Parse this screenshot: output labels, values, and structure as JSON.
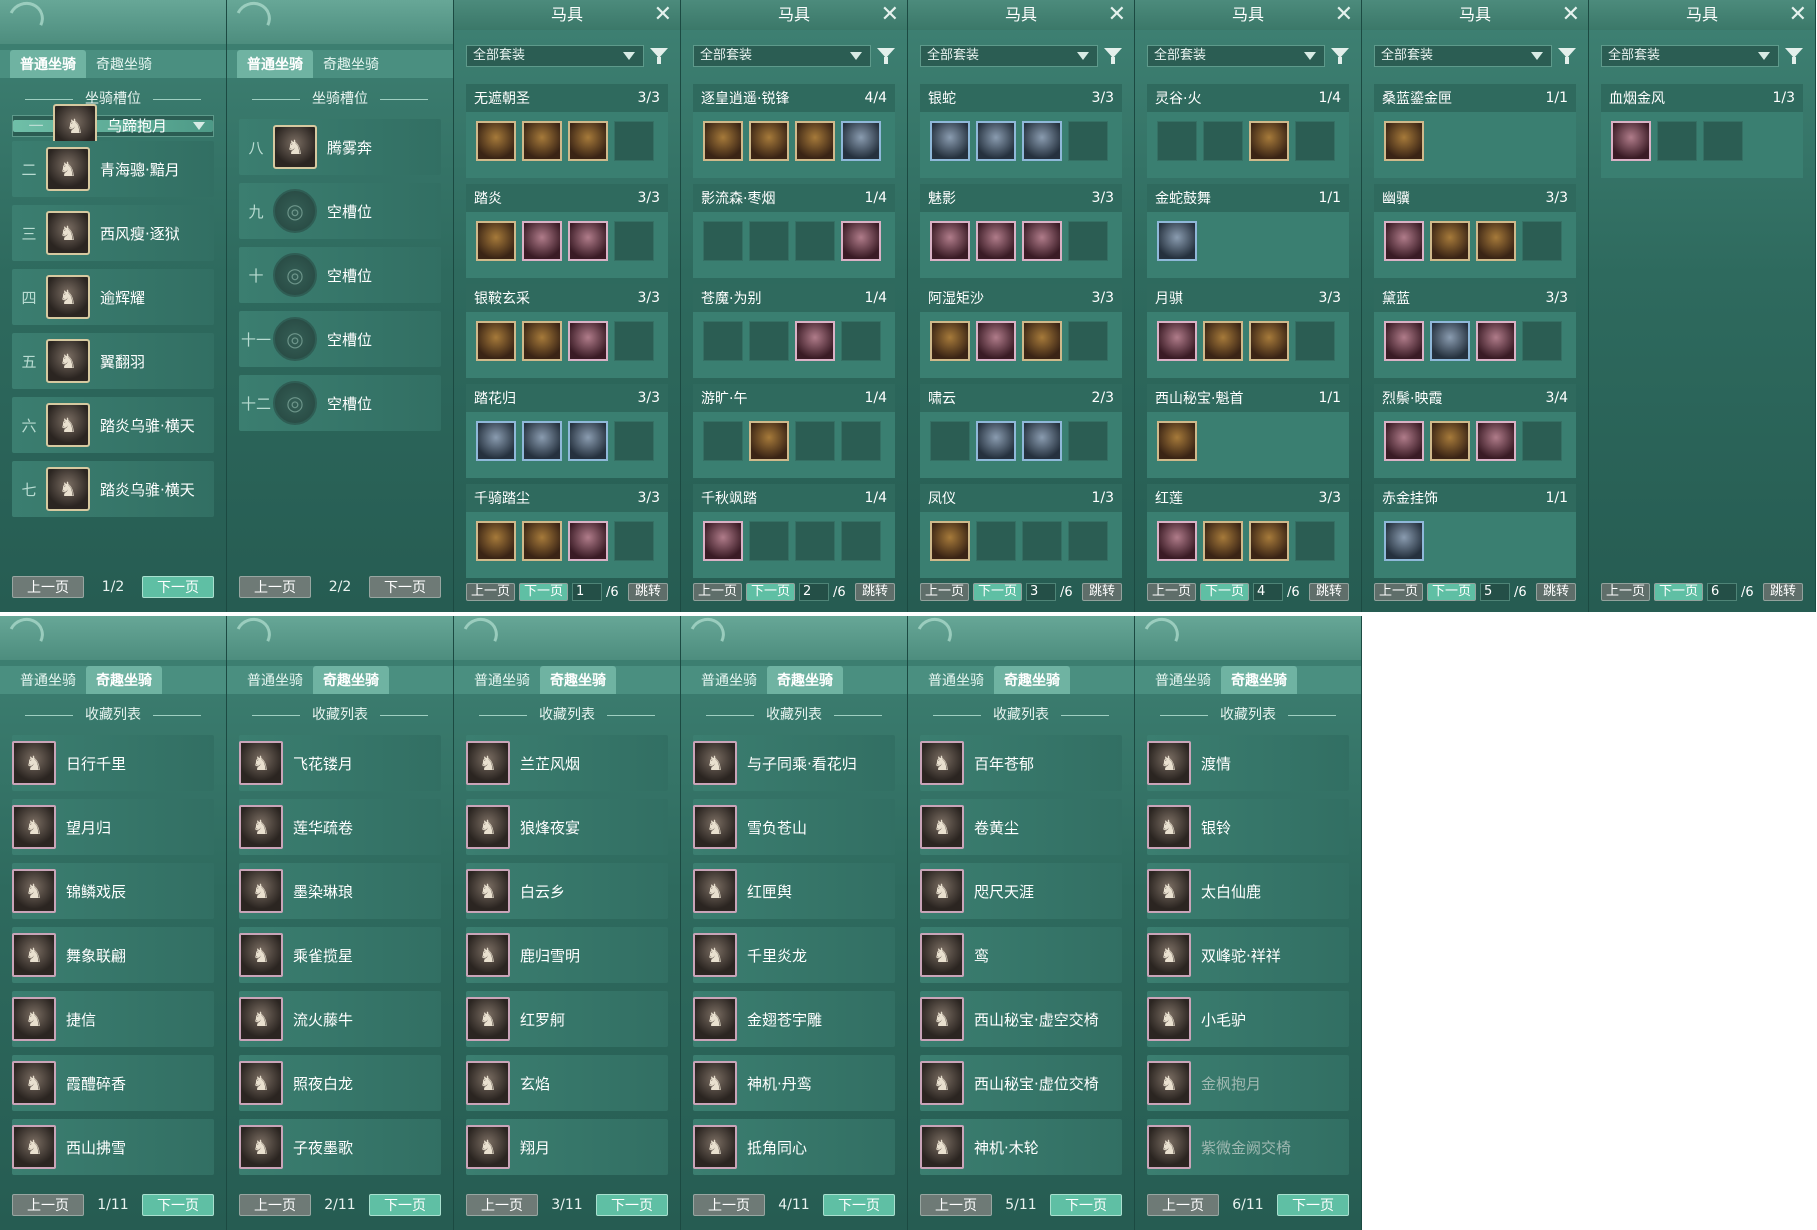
{
  "tabs": {
    "normal": "普通坐骑",
    "fun": "奇趣坐骑"
  },
  "slots": {
    "header": "坐骑槽位",
    "pages": [
      {
        "items": [
          {
            "n": "一",
            "name": "乌蹄抱月",
            "sel": true
          },
          {
            "n": "二",
            "name": "青海骢·黯月"
          },
          {
            "n": "三",
            "name": "西风瘦·逐狱"
          },
          {
            "n": "四",
            "name": "逾辉耀"
          },
          {
            "n": "五",
            "name": "翼翻羽"
          },
          {
            "n": "六",
            "name": "踏炎乌骓·横天"
          },
          {
            "n": "七",
            "name": "踏炎乌骓·横天"
          }
        ],
        "page": "1/2"
      },
      {
        "items": [
          {
            "n": "八",
            "name": "腾雾奔"
          },
          {
            "n": "九",
            "name": "空槽位",
            "empty": true
          },
          {
            "n": "十",
            "name": "空槽位",
            "empty": true
          },
          {
            "n": "十一",
            "name": "空槽位",
            "empty": true
          },
          {
            "n": "十二",
            "name": "空槽位",
            "empty": true
          }
        ],
        "page": "2/2"
      }
    ],
    "prev": "上一页",
    "next": "下一页"
  },
  "tack": {
    "title": "马具",
    "filter": "全部套装",
    "prev": "上一页",
    "next": "下一页",
    "jump": "跳转",
    "total": "/6",
    "pages": [
      {
        "page": "1",
        "sets": [
          {
            "name": "无遮朝圣",
            "count": "3/3",
            "slots": [
              "f",
              "f",
              "f",
              "e"
            ]
          },
          {
            "name": "踏炎",
            "count": "3/3",
            "slots": [
              "f",
              "p",
              "p",
              "e"
            ]
          },
          {
            "name": "银鞍玄采",
            "count": "3/3",
            "slots": [
              "f",
              "f",
              "p",
              "e"
            ]
          },
          {
            "name": "踏花归",
            "count": "3/3",
            "slots": [
              "b",
              "b",
              "b",
              "e"
            ]
          },
          {
            "name": "千骑踏尘",
            "count": "3/3",
            "slots": [
              "f",
              "f",
              "p",
              "e"
            ]
          }
        ]
      },
      {
        "page": "2",
        "sets": [
          {
            "name": "逐皇逍遥·锐锋",
            "count": "4/4",
            "slots": [
              "f",
              "f",
              "f",
              "b"
            ]
          },
          {
            "name": "影流森·枣烟",
            "count": "1/4",
            "slots": [
              "e",
              "e",
              "e",
              "p"
            ]
          },
          {
            "name": "苍魔·为别",
            "count": "1/4",
            "slots": [
              "e",
              "e",
              "p",
              "e"
            ]
          },
          {
            "name": "游旷·午",
            "count": "1/4",
            "slots": [
              "e",
              "f",
              "e",
              "e"
            ]
          },
          {
            "name": "千秋飒踏",
            "count": "1/4",
            "slots": [
              "p",
              "e",
              "e",
              "e"
            ]
          }
        ]
      },
      {
        "page": "3",
        "sets": [
          {
            "name": "银蛇",
            "count": "3/3",
            "slots": [
              "b",
              "b",
              "b",
              "e"
            ]
          },
          {
            "name": "魅影",
            "count": "3/3",
            "slots": [
              "p",
              "p",
              "p",
              "e"
            ]
          },
          {
            "name": "阿湿矩沙",
            "count": "3/3",
            "slots": [
              "f",
              "p",
              "f",
              "e"
            ]
          },
          {
            "name": "啸云",
            "count": "2/3",
            "slots": [
              "e",
              "b",
              "b",
              "e"
            ]
          },
          {
            "name": "凤仪",
            "count": "1/3",
            "slots": [
              "f",
              "e",
              "e",
              "e"
            ]
          }
        ]
      },
      {
        "page": "4",
        "sets": [
          {
            "name": "灵谷·火",
            "count": "1/4",
            "slots": [
              "e",
              "e",
              "f",
              "e"
            ]
          },
          {
            "name": "金蛇鼓舞",
            "count": "1/1",
            "slots": [
              "b",
              "x",
              "x",
              "x"
            ]
          },
          {
            "name": "月骐",
            "count": "3/3",
            "slots": [
              "p",
              "f",
              "f",
              "e"
            ]
          },
          {
            "name": "西山秘宝·魁首",
            "count": "1/1",
            "slots": [
              "f",
              "x",
              "x",
              "x"
            ]
          },
          {
            "name": "红莲",
            "count": "3/3",
            "slots": [
              "p",
              "f",
              "f",
              "e"
            ]
          }
        ]
      },
      {
        "page": "5",
        "sets": [
          {
            "name": "桑蓝鎏金匣",
            "count": "1/1",
            "slots": [
              "f",
              "x",
              "x",
              "x"
            ]
          },
          {
            "name": "幽骥",
            "count": "3/3",
            "slots": [
              "p",
              "f",
              "f",
              "e"
            ]
          },
          {
            "name": "黛蓝",
            "count": "3/3",
            "slots": [
              "p",
              "b",
              "p",
              "e"
            ]
          },
          {
            "name": "烈鬃·映霞",
            "count": "3/4",
            "slots": [
              "p",
              "f",
              "p",
              "e"
            ]
          },
          {
            "name": "赤金挂饰",
            "count": "1/1",
            "slots": [
              "b",
              "x",
              "x",
              "x"
            ]
          }
        ]
      },
      {
        "page": "6",
        "sets": [
          {
            "name": "血烟金风",
            "count": "1/3",
            "slots": [
              "p",
              "e",
              "e",
              "x"
            ]
          }
        ]
      }
    ]
  },
  "collection": {
    "header": "收藏列表",
    "prev": "上一页",
    "next": "下一页",
    "pages": [
      {
        "page": "1/11",
        "items": [
          "日行千里",
          "望月归",
          "锦鳞戏辰",
          "舞象联翩",
          "捷信",
          "霞醴碎香",
          "西山拂雪"
        ]
      },
      {
        "page": "2/11",
        "items": [
          "飞花镂月",
          "莲华疏卷",
          "墨染琳琅",
          "乘雀揽星",
          "流火藤牛",
          "照夜白龙",
          "子夜墨歌"
        ]
      },
      {
        "page": "3/11",
        "items": [
          "兰芷风烟",
          "狼烽夜宴",
          "白云乡",
          "鹿归雪明",
          "红罗舸",
          "玄焰",
          "翔月"
        ]
      },
      {
        "page": "4/11",
        "items": [
          "与子同乘·看花归",
          "雪负苍山",
          "红匣舆",
          "千里炎龙",
          "金翅苍宇雕",
          "神机·丹鸾",
          "抵角同心"
        ]
      },
      {
        "page": "5/11",
        "items": [
          "百年苍郁",
          "卷黄尘",
          "咫尺天涯",
          "鸾",
          "西山秘宝·虚空交椅",
          "西山秘宝·虚位交椅",
          "神机·木轮"
        ]
      },
      {
        "page": "6/11",
        "items": [
          "渡情",
          "银铃",
          "太白仙鹿",
          "双峰驼·祥祥",
          "小毛驴",
          "金枫抱月",
          "紫微金阙交椅"
        ],
        "dim": [
          5,
          6
        ]
      }
    ]
  }
}
